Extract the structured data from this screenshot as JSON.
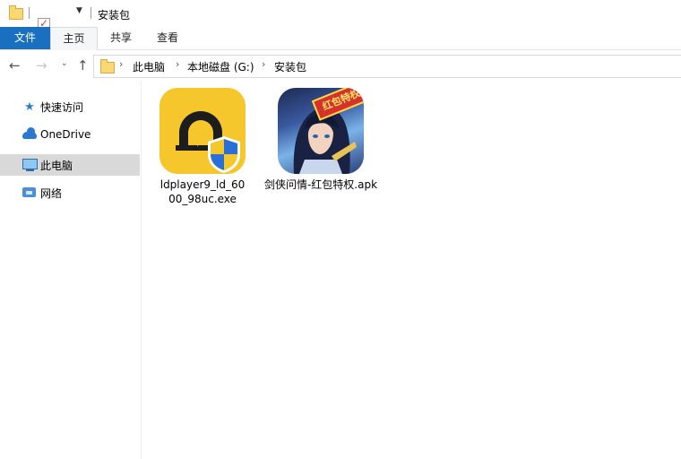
{
  "window": {
    "title": "安装包"
  },
  "ribbon": {
    "tabs": [
      {
        "label": "文件"
      },
      {
        "label": "主页"
      },
      {
        "label": "共享"
      },
      {
        "label": "查看"
      }
    ],
    "active": "主页"
  },
  "address": {
    "crumbs": [
      "此电脑",
      "本地磁盘 (G:)",
      "安装包"
    ]
  },
  "sidebar": {
    "items": [
      {
        "label": "快速访问",
        "icon": "star-icon"
      },
      {
        "label": "OneDrive",
        "icon": "cloud-icon"
      },
      {
        "label": "此电脑",
        "icon": "computer-icon",
        "selected": true
      },
      {
        "label": "网络",
        "icon": "network-icon"
      }
    ]
  },
  "files": [
    {
      "name_line1": "ldplayer9_ld_60",
      "name_line2": "00_98uc.exe",
      "icon": "ldplayer-app-icon"
    },
    {
      "name": "剑侠问情-红包特权.apk",
      "icon": "game-apk-icon",
      "badge": "红包特权"
    }
  ],
  "colors": {
    "file_tab": "#1a6fc1",
    "selection": "#d9d9d9",
    "ld_yellow": "#f6c62d"
  }
}
